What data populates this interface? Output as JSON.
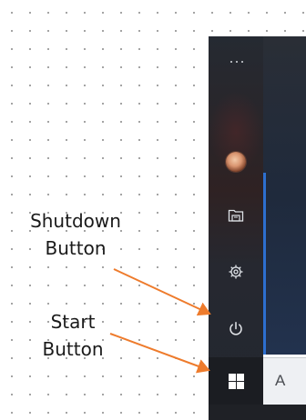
{
  "annotations": {
    "shutdown_label": "Shutdown\nButton",
    "start_label": "Start\nButton",
    "arrow_color": "#ee7b2c"
  },
  "start_menu": {
    "sidebar_buttons": [
      {
        "name": "menu-icon"
      },
      {
        "name": "user-avatar"
      },
      {
        "name": "documents-icon"
      },
      {
        "name": "gear-icon"
      },
      {
        "name": "power-icon"
      }
    ],
    "start_icon": "windows-logo-icon"
  },
  "taskbar": {
    "search_visible_text": "A"
  }
}
